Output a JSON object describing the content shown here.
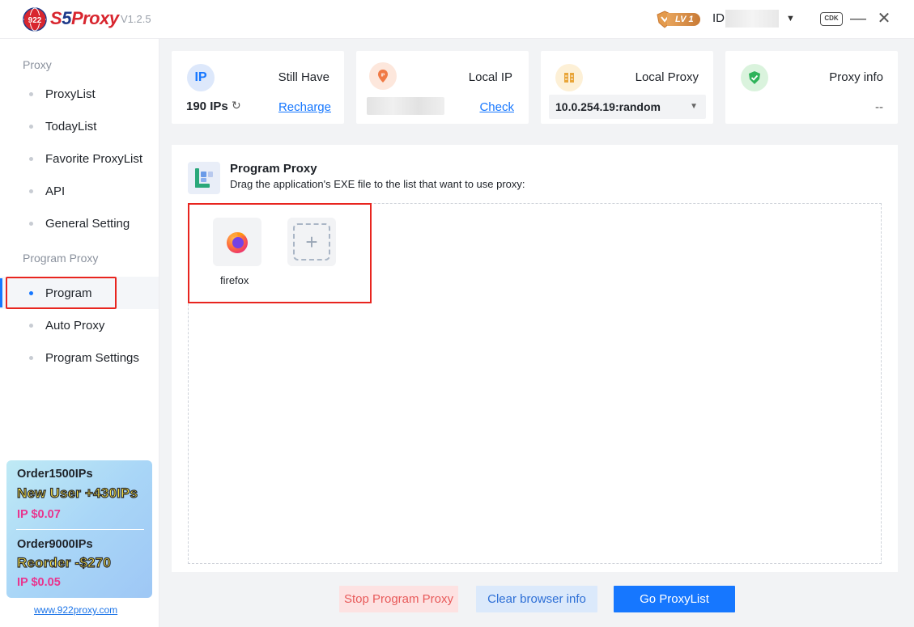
{
  "app": {
    "logo_text": "922",
    "brand_s": "S",
    "brand_5": "5",
    "brand_proxy": "Proxy",
    "version": "V1.2.5",
    "level": "LV 1",
    "id_label": "ID:",
    "cdk": "CDK"
  },
  "sidebar": {
    "section_proxy": "Proxy",
    "proxy_items": [
      "ProxyList",
      "TodayList",
      "Favorite ProxyList",
      "API",
      "General Setting"
    ],
    "section_program": "Program Proxy",
    "program_items": [
      "Program",
      "Auto Proxy",
      "Program Settings"
    ],
    "active_item": "Program"
  },
  "promo": {
    "order1": "Order1500IPs",
    "headline1": "New User +430IPs",
    "price1": "IP $0.07",
    "order2": "Order9000IPs",
    "headline2": "Reorder -$270",
    "price2": "IP $0.05",
    "site": "www.922proxy.com"
  },
  "cards": {
    "ip": {
      "icon_text": "IP",
      "title": "Still Have",
      "count": "190 IPs",
      "link": "Recharge"
    },
    "local_ip": {
      "icon_text": "IP",
      "title": "Local IP",
      "link": "Check"
    },
    "local_proxy": {
      "title": "Local Proxy",
      "selected": "10.0.254.19:random"
    },
    "proxy_info": {
      "title": "Proxy info",
      "value": "--"
    }
  },
  "program_proxy": {
    "title": "Program Proxy",
    "subtitle": "Drag the application's EXE file to the list that want to use proxy:",
    "apps": [
      {
        "name": "firefox"
      }
    ]
  },
  "buttons": {
    "stop": "Stop Program Proxy",
    "clear": "Clear browser info",
    "go": "Go ProxyList"
  },
  "colors": {
    "accent": "#1677ff",
    "highlight_red": "#e8251f",
    "brand_red": "#d8262f",
    "promo_pink": "#e8368f"
  }
}
